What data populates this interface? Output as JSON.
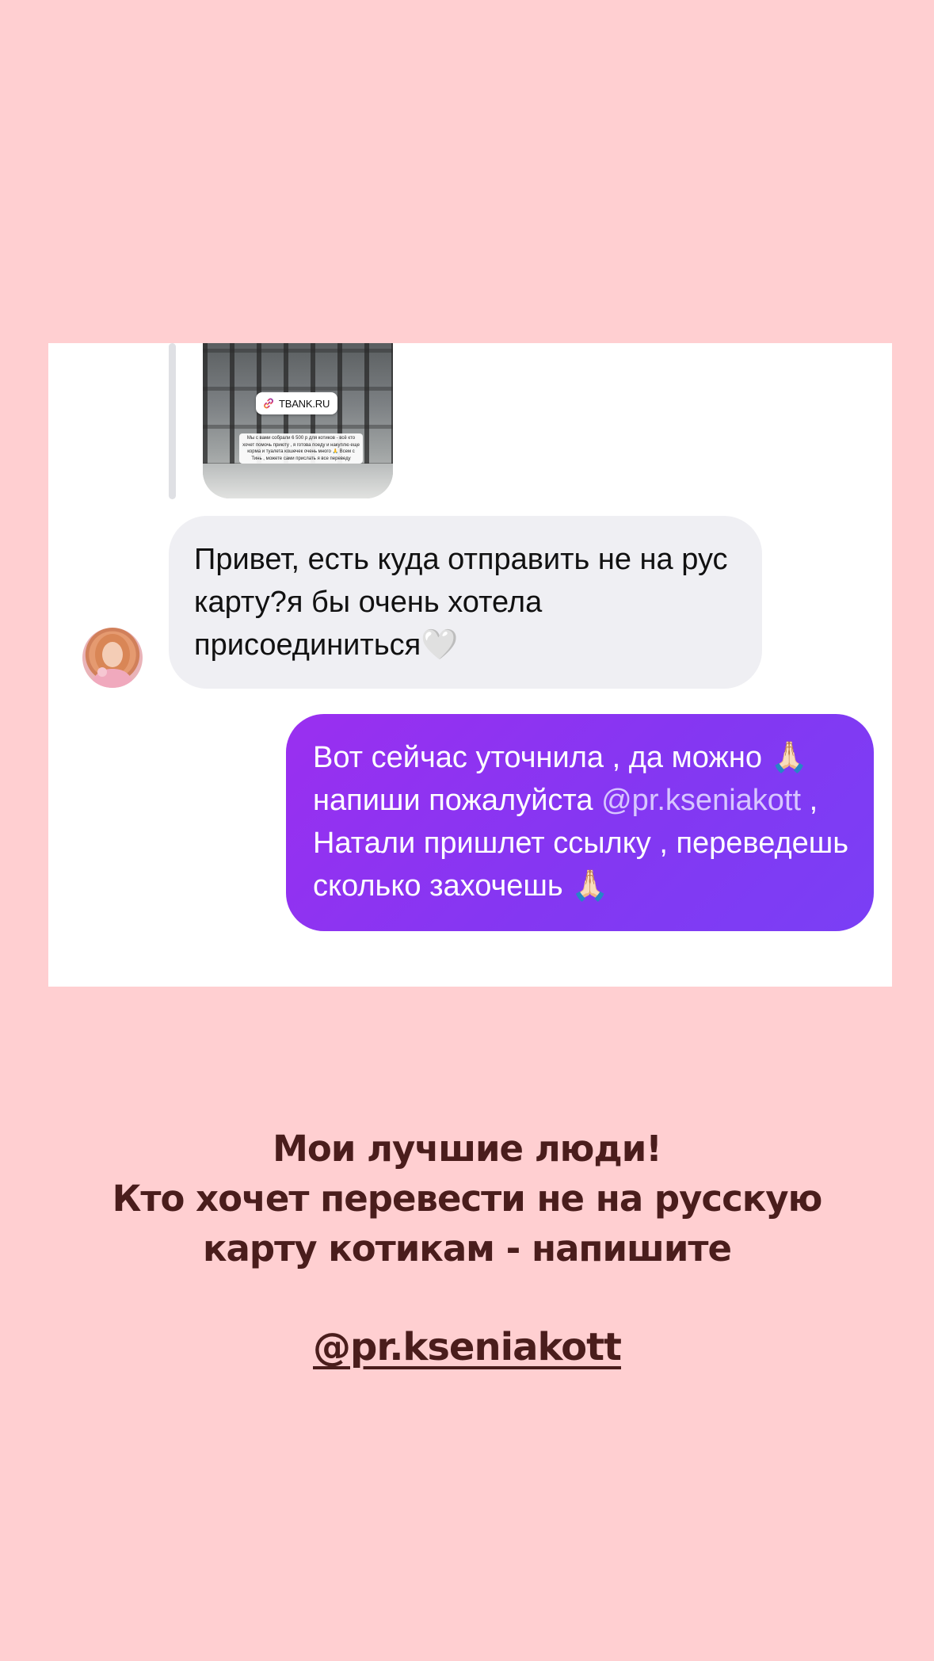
{
  "story_link_sticker": {
    "label": "TBANK.RU"
  },
  "story_caption": "Мы с вами собрали 6 500 р для котиков - всё кто хочет помочь приюту , я готова поеду и накуплю еще корма и туалета кошечек очень много 🙏 Всем с Тинь , можете сами прислать я все переведу",
  "chat": {
    "incoming_message": "Привет, есть куда отправить не на рус карту?я бы очень хотела присоединиться🤍",
    "outgoing_message_part1": "Вот сейчас уточнила , да можно 🙏🏻 напиши пожалуйста ",
    "outgoing_mention": "@pr.kseniakott",
    "outgoing_message_part2": " , Натали пришлет ссылку , переведешь сколько захочешь 🙏🏻"
  },
  "headline": {
    "line1": "Мои лучшие люди!",
    "line2": "Кто хочет перевести не на русскую",
    "line3": "карту котикам - напишите"
  },
  "mention_sticker": "@pr.kseniakott",
  "colors": {
    "background": "#ffcfd1",
    "outgoing_bubble": "#8a38f2",
    "incoming_bubble": "#efeff3",
    "headline_text": "#4a1d1c"
  }
}
